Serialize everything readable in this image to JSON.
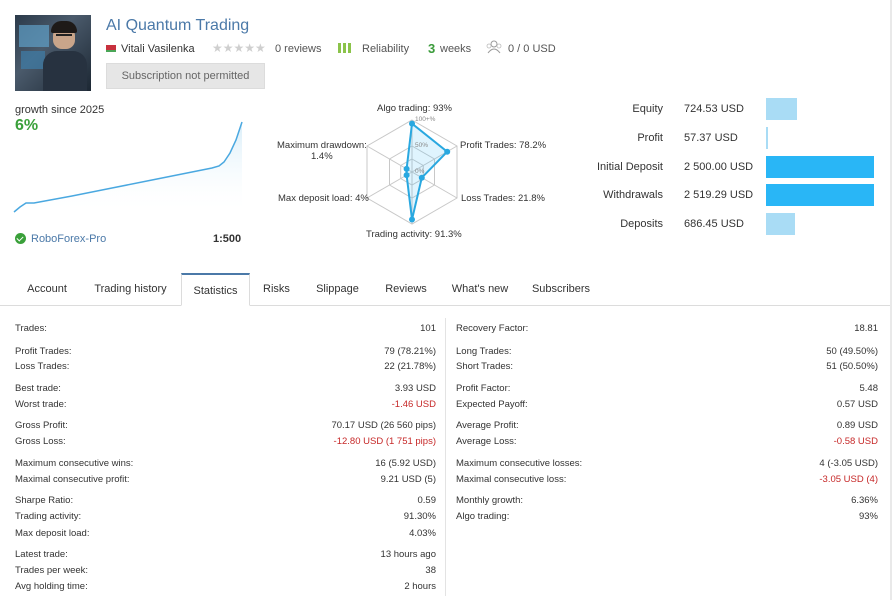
{
  "header": {
    "title": "AI Quantum Trading",
    "author": "Vitali Vasilenka",
    "stars": "★★★★★",
    "reviews": "0 reviews",
    "reliability": "Reliability",
    "weeks_num": "3",
    "weeks": "weeks",
    "subscribers": "0 / 0 USD",
    "subscribe_button": "Subscription not permitted"
  },
  "growth": {
    "label": "growth since 2025",
    "value": "6%",
    "broker": "RoboForex-Pro",
    "leverage": "1:500"
  },
  "radar": {
    "labels": {
      "algo": "Algo trading: 93%",
      "profit": "Profit Trades: 78.2%",
      "loss": "Loss Trades: 21.8%",
      "activity": "Trading activity: 91.3%",
      "load": "Max deposit load: 4%",
      "drawdown_1": "Maximum drawdown:",
      "drawdown_2": "1.4%",
      "ring_100": "100+%",
      "ring_50": "50%",
      "ring_0": "0%"
    },
    "values": [
      0.93,
      0.782,
      0.218,
      0.913,
      0.04,
      0.014
    ]
  },
  "finance": [
    {
      "label": "Equity",
      "value": "724.53 USD",
      "ratio": 0.29,
      "color": "#a9dcf5"
    },
    {
      "label": "Profit",
      "value": "57.37 USD",
      "ratio": 0.02,
      "color": "#a9dcf5"
    },
    {
      "label": "Initial Deposit",
      "value": "2 500.00 USD",
      "ratio": 1.0,
      "color": "#29b6f6"
    },
    {
      "label": "Withdrawals",
      "value": "2 519.29 USD",
      "ratio": 1.0,
      "color": "#29b6f6"
    },
    {
      "label": "Deposits",
      "value": "686.45 USD",
      "ratio": 0.27,
      "color": "#a9dcf5"
    }
  ],
  "tabs": [
    "Account",
    "Trading history",
    "Statistics",
    "Risks",
    "Slippage",
    "Reviews",
    "What's new",
    "Subscribers"
  ],
  "stats_left": [
    {
      "label": "Trades:",
      "value": "101"
    },
    {
      "label": "Profit Trades:",
      "value": "79 (78.21%)"
    },
    {
      "label": "Loss Trades:",
      "value": "22 (21.78%)"
    },
    {
      "label": "Best trade:",
      "value": "3.93 USD"
    },
    {
      "label": "Worst trade:",
      "value": "-1.46 USD",
      "neg": true
    },
    {
      "label": "Gross Profit:",
      "value": "70.17 USD (26 560 pips)"
    },
    {
      "label": "Gross Loss:",
      "value": "-12.80 USD (1 751 pips)",
      "neg": true
    },
    {
      "label": "Maximum consecutive wins:",
      "value": "16 (5.92 USD)"
    },
    {
      "label": "Maximal consecutive profit:",
      "value": "9.21 USD (5)"
    },
    {
      "label": "Sharpe Ratio:",
      "value": "0.59"
    },
    {
      "label": "Trading activity:",
      "value": "91.30%"
    },
    {
      "label": "Max deposit load:",
      "value": "4.03%"
    },
    {
      "label": "Latest trade:",
      "value": "13 hours ago"
    },
    {
      "label": "Trades per week:",
      "value": "38"
    },
    {
      "label": "Avg holding time:",
      "value": "2 hours"
    }
  ],
  "stats_right": [
    {
      "label": "Recovery Factor:",
      "value": "18.81"
    },
    {
      "label": "Long Trades:",
      "value": "50 (49.50%)"
    },
    {
      "label": "Short Trades:",
      "value": "51 (50.50%)"
    },
    {
      "label": "Profit Factor:",
      "value": "5.48"
    },
    {
      "label": "Expected Payoff:",
      "value": "0.57 USD"
    },
    {
      "label": "Average Profit:",
      "value": "0.89 USD"
    },
    {
      "label": "Average Loss:",
      "value": "-0.58 USD",
      "neg": true
    },
    {
      "label": "Maximum consecutive losses:",
      "value": "4 (-3.05 USD)"
    },
    {
      "label": "Maximal consecutive loss:",
      "value": "-3.05 USD (4)",
      "neg": true
    },
    {
      "label": "Monthly growth:",
      "value": "6.36%"
    },
    {
      "label": "Algo trading:",
      "value": "93%"
    }
  ]
}
